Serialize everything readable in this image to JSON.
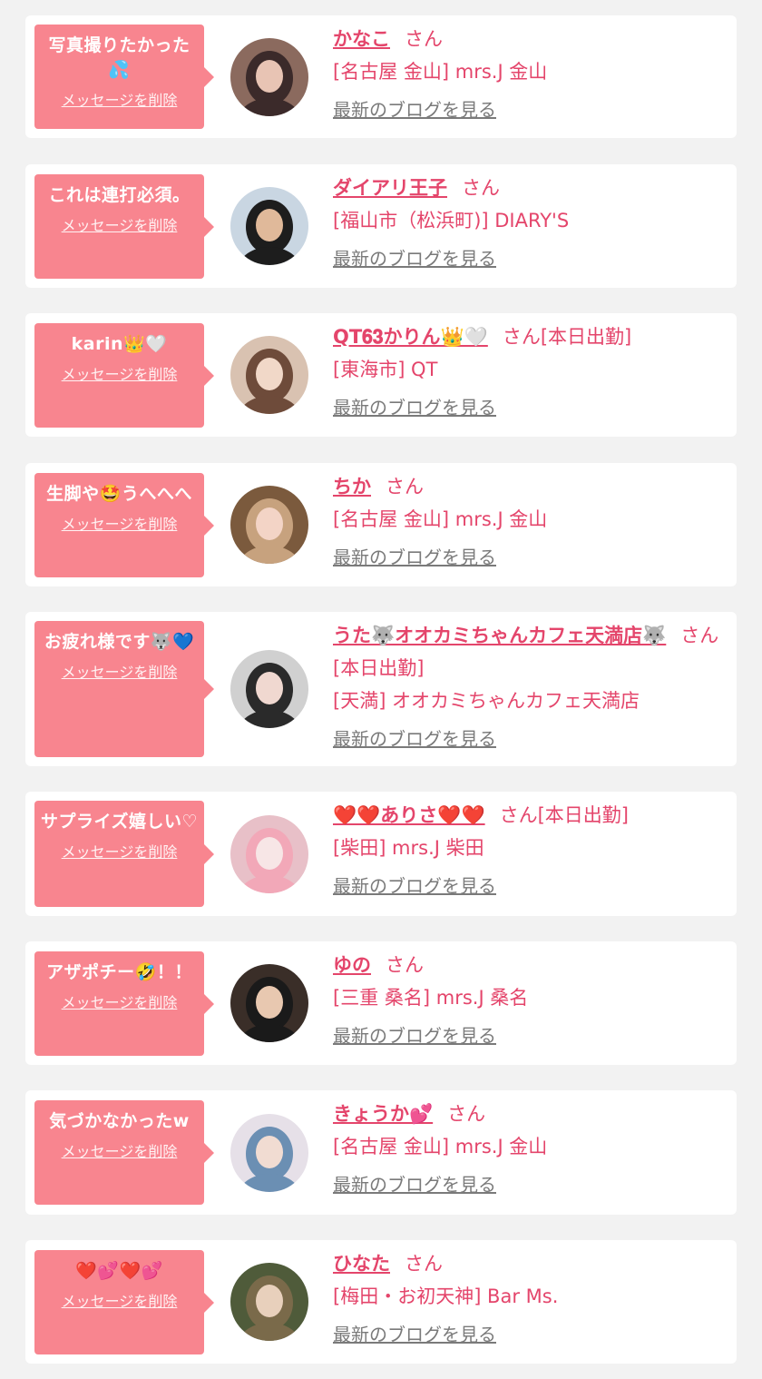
{
  "delete_label": "メッセージを削除",
  "blog_label": "最新のブログを見る",
  "colors": {
    "bubble": "#f8858f",
    "accent": "#e4456b",
    "link_gray": "#7a7a7a",
    "background": "#f2f2f2"
  },
  "items": [
    {
      "message": "写真撮りたかった💦",
      "name": "かなこ",
      "suffix": "さん",
      "shop": "[名古屋 金山] mrs.J 金山",
      "avatar": "avatar-photo"
    },
    {
      "message": "これは連打必須。",
      "name": "ダイアリ王子",
      "suffix": "さん",
      "shop": "[福山市（松浜町)] DIARY'S",
      "avatar": "avatar-photo"
    },
    {
      "message": "karin👑🤍",
      "name": "QT𝟔𝟑かりん👑🤍",
      "suffix": "さん[本日出勤]",
      "shop": "[東海市] QT",
      "avatar": "avatar-photo"
    },
    {
      "message": "生脚や🤩うへへへ",
      "name": "ちか",
      "suffix": "さん",
      "shop": "[名古屋 金山] mrs.J 金山",
      "avatar": "avatar-photo"
    },
    {
      "message": "お疲れ様です🐺💙",
      "name": "うた🐺オオカミちゃんカフェ天満店🐺",
      "suffix": "さん[本日出勤]",
      "shop": "[天満] オオカミちゃんカフェ天満店",
      "avatar": "avatar-photo"
    },
    {
      "message": "サプライズ嬉しい♡",
      "name": "❤️❤️ありさ❤️❤️",
      "suffix": "さん[本日出勤]",
      "shop": "[柴田] mrs.J 柴田",
      "avatar": "avatar-photo"
    },
    {
      "message": "アザポチー🤣！！",
      "name": "ゆの",
      "suffix": "さん",
      "shop": "[三重 桑名] mrs.J 桑名",
      "avatar": "avatar-photo"
    },
    {
      "message": "気づかなかったw",
      "name": "きょうか💕",
      "suffix": "さん",
      "shop": "[名古屋 金山] mrs.J 金山",
      "avatar": "avatar-photo"
    },
    {
      "message": "❤️💕❤️💕",
      "name": "ひなた",
      "suffix": "さん",
      "shop": "[梅田・お初天神] Bar Ms.",
      "avatar": "avatar-photo"
    }
  ]
}
